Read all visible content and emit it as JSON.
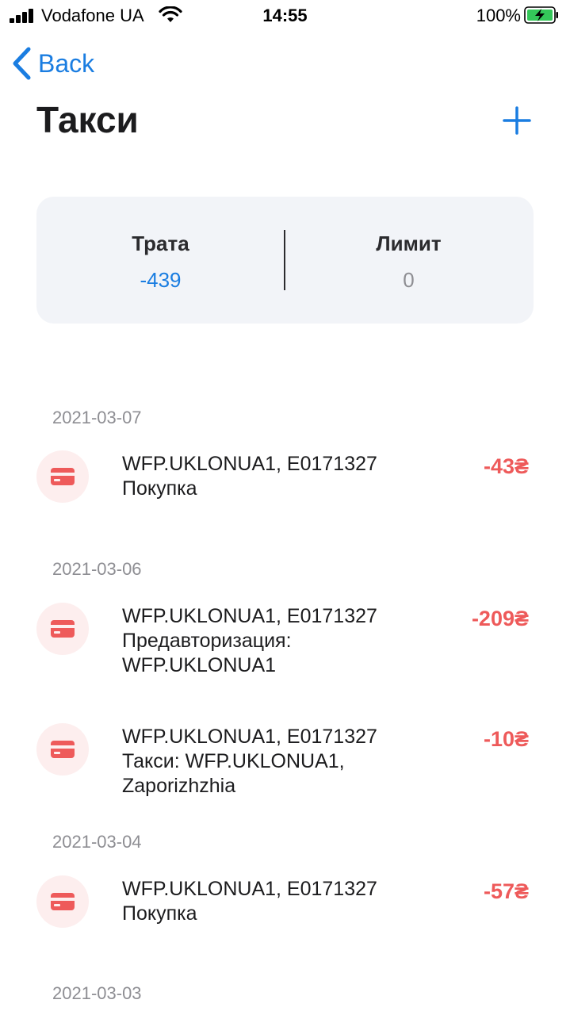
{
  "status_bar": {
    "carrier": "Vodafone UA",
    "time": "14:55",
    "battery": "100%"
  },
  "nav": {
    "back_label": "Back",
    "title": "Такси"
  },
  "summary": {
    "spend_label": "Трата",
    "spend_value": "-439",
    "limit_label": "Лимит",
    "limit_value": "0"
  },
  "colors": {
    "accent": "#1a7de1",
    "negative": "#ee5a5a",
    "card_bg": "#f2f4f8"
  },
  "groups": [
    {
      "date": "2021-03-07",
      "transactions": [
        {
          "merchant": "WFP.UKLONUA1, E0171327",
          "description": "Покупка",
          "amount": "-43₴",
          "icon": "card-icon"
        }
      ]
    },
    {
      "date": "2021-03-06",
      "transactions": [
        {
          "merchant": "WFP.UKLONUA1, E0171327",
          "description": "Предавторизация:",
          "description2": "WFP.UKLONUA1",
          "amount": "-209₴",
          "icon": "card-icon"
        },
        {
          "merchant": "WFP.UKLONUA1, E0171327",
          "description": "Такси: WFP.UKLONUA1,",
          "description2": "Zaporizhzhia",
          "amount": "-10₴",
          "icon": "card-icon"
        }
      ]
    },
    {
      "date": "2021-03-04",
      "transactions": [
        {
          "merchant": "WFP.UKLONUA1, E0171327",
          "description": "Покупка",
          "amount": "-57₴",
          "icon": "card-icon"
        }
      ]
    },
    {
      "date": "2021-03-03",
      "transactions": []
    }
  ]
}
